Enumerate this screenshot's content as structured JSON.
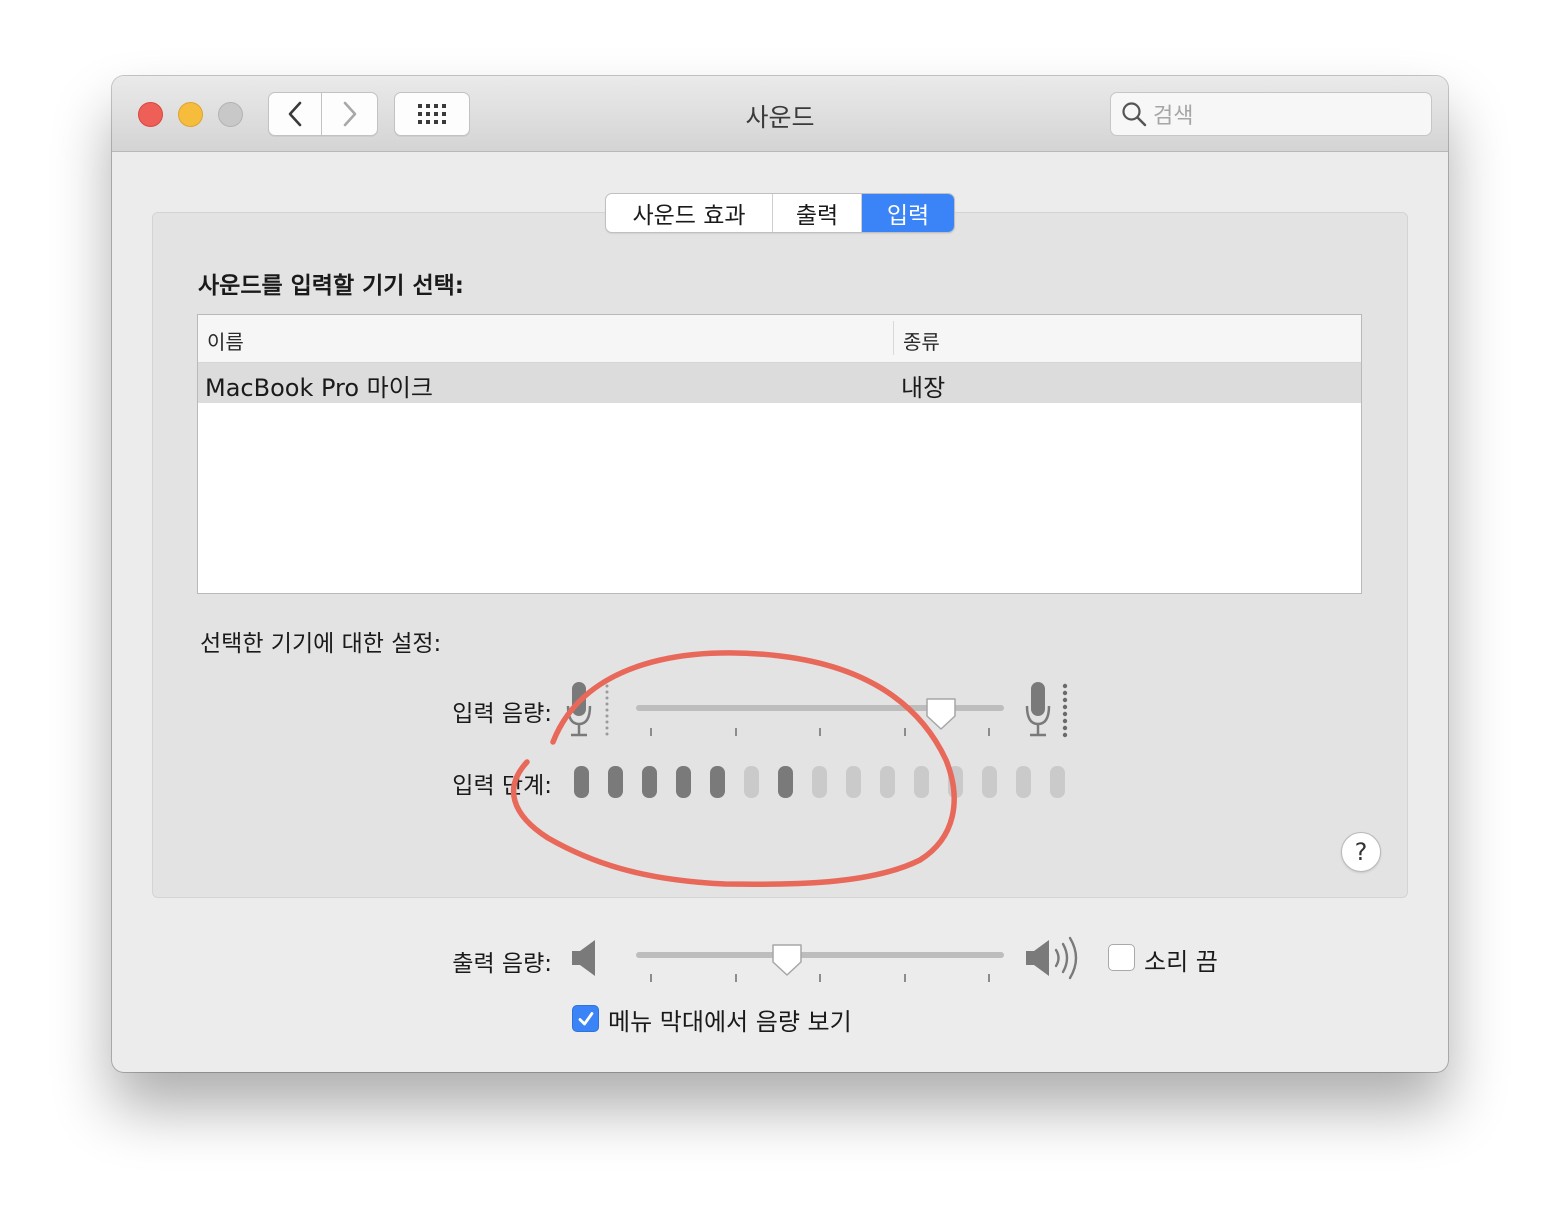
{
  "window": {
    "title": "사운드"
  },
  "search": {
    "placeholder": "검색"
  },
  "tabs": [
    {
      "label": "사운드 효과",
      "active": false
    },
    {
      "label": "출력",
      "active": false
    },
    {
      "label": "입력",
      "active": true
    }
  ],
  "input": {
    "heading": "사운드를 입력할 기기 선택:",
    "table": {
      "columns": [
        "이름",
        "종류"
      ],
      "rows": [
        {
          "name": "MacBook Pro 마이크",
          "type": "내장",
          "selected": true
        }
      ]
    },
    "settings_label": "선택한 기기에 대한 설정:",
    "volume_label": "입력 음량:",
    "volume_level": 0.83,
    "level_label": "입력 단계:",
    "level_meter": [
      1,
      1,
      1,
      1,
      1,
      0,
      1,
      0,
      0,
      0,
      0,
      0,
      0,
      0,
      0
    ]
  },
  "output": {
    "volume_label": "출력 음량:",
    "volume_level": 0.41,
    "mute_label": "소리 끔",
    "mute_checked": false,
    "menubar_label": "메뉴 막대에서 음량 보기",
    "menubar_checked": true
  },
  "colors": {
    "accent": "#3a84f7",
    "annotation": "#e8685a",
    "meter_on": "#7a7a7a",
    "meter_off": "#cacaca"
  },
  "icons": [
    "back-chevron-icon",
    "forward-chevron-icon",
    "grid-icon",
    "search-icon",
    "microphone-low-icon",
    "microphone-high-icon",
    "speaker-low-icon",
    "speaker-high-icon",
    "question-icon",
    "checkmark-icon"
  ]
}
